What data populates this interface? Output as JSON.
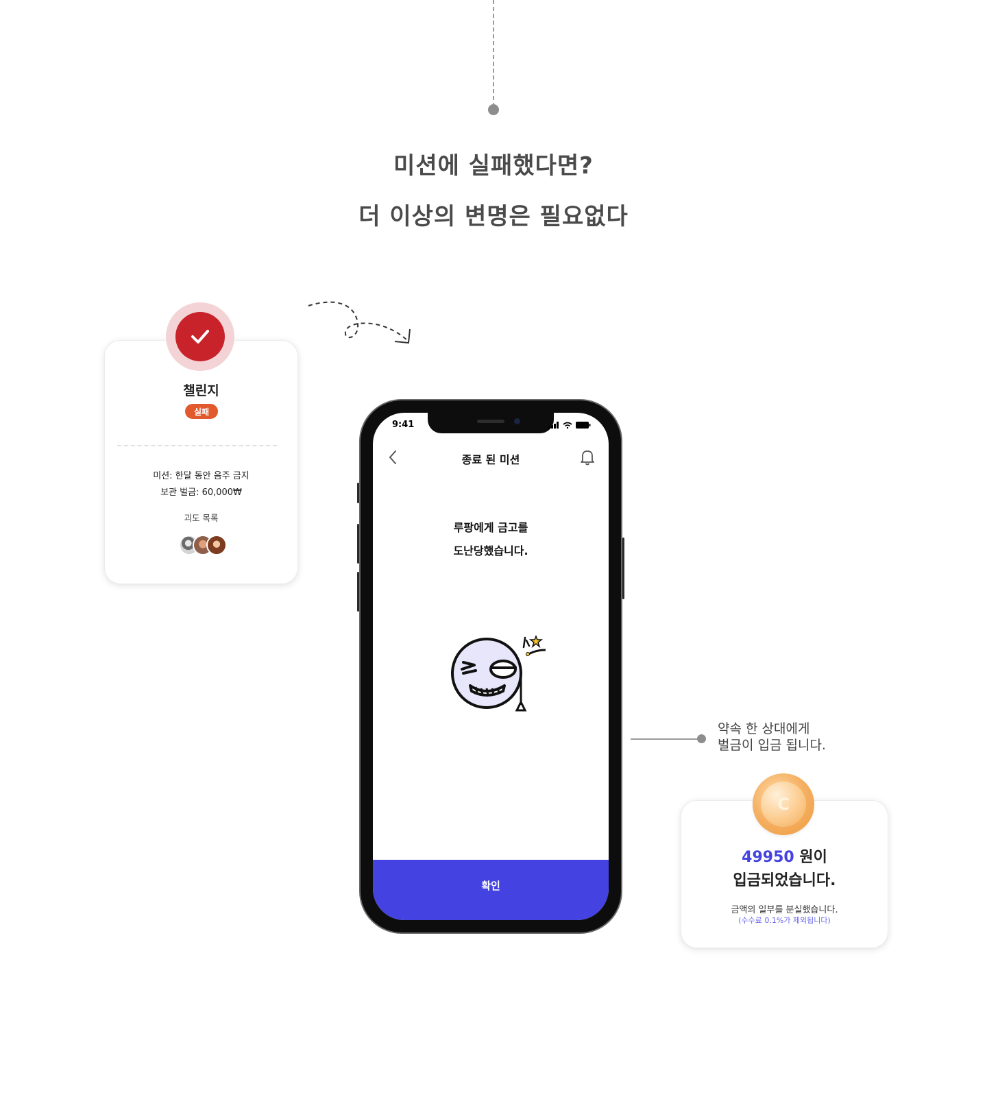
{
  "headline": {
    "line1": "미션에 실패했다면?",
    "line2": "더 이상의 변명은 필요없다"
  },
  "challenge_card": {
    "title": "챌린지",
    "status_badge": "실패",
    "mission": "미션: 한달 동안 음주 금지",
    "deposit": "보관 벌금: 60,000₩",
    "list_label": "괴도 목록",
    "check_icon": "check-icon",
    "avatars": [
      "avatar-1",
      "avatar-2",
      "avatar-3"
    ]
  },
  "phone": {
    "status_time": "9:41",
    "nav_title": "종료 된 미션",
    "message_line1": "루팡에게 금고를",
    "message_line2": "도난당했습니다.",
    "confirm_label": "확인",
    "accent_color": "#4442e0"
  },
  "connector": {
    "line1": "약속 한 상대에게",
    "line2": "벌금이 입금 됩니다."
  },
  "deposit_card": {
    "amount": "49950",
    "amount_suffix": " 원이",
    "title_line2": "입금되었습니다.",
    "note": "금액의 일부를 분실했습니다.",
    "fee_note": "(수수료 0.1%가 제외됩니다)",
    "coin_letter": "C"
  }
}
